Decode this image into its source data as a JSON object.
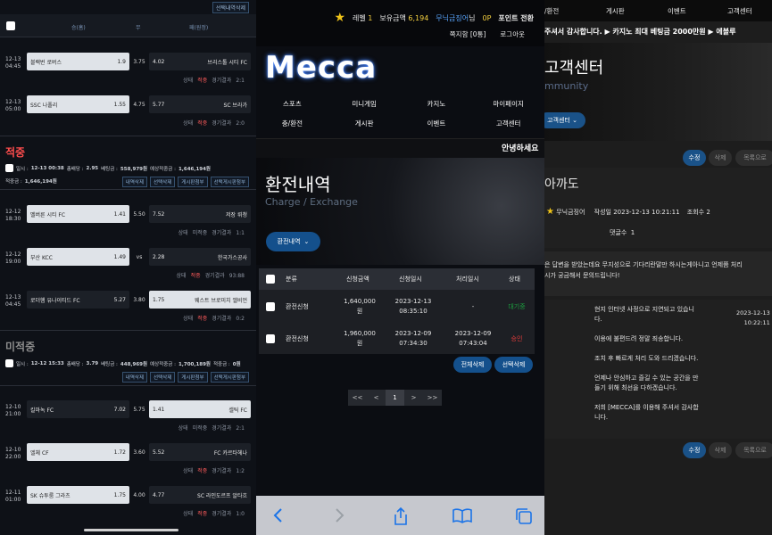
{
  "left": {
    "top_button": "선택내역삭제",
    "header": {
      "home": "승(홈)",
      "draw": "무",
      "away": "패(원정)"
    },
    "group1": [
      {
        "time1": "12-13",
        "time2": "04:45",
        "home": "블랙번 로버스",
        "home_odds": "1.9",
        "draw": "3.75",
        "away_odds": "4.02",
        "away": "브리스톨 시티 FC",
        "state": "상태",
        "mark": "적중",
        "result": "경기결과",
        "score": "2:1"
      },
      {
        "time1": "12-13",
        "time2": "05:00",
        "home": "SSC 나폴리",
        "home_odds": "1.55",
        "draw": "4.75",
        "away_odds": "5.77",
        "away": "SC 브라가",
        "state": "상태",
        "mark": "적중",
        "result": "경기결과",
        "score": "2:0"
      }
    ],
    "section_hit": "적중",
    "hit_info": {
      "date_label": "일시 :",
      "date": "12-13 00:38",
      "total_odds_label": "총배당 :",
      "total_odds": "2.95",
      "bet_label": "베팅금 :",
      "bet": "558,979원",
      "exp_label": "예상적중금 :",
      "exp": "1,646,194원",
      "win_label": "적중금 :",
      "win": "1,646,194원"
    },
    "buttons": [
      "내역삭제",
      "선택삭제",
      "게시판첨부",
      "선택게시판첨부"
    ],
    "group2": [
      {
        "time1": "12-12",
        "time2": "18:30",
        "home": "멜버른 시티 FC",
        "home_odds": "1.41",
        "draw": "5.50",
        "away_odds": "7.52",
        "away": "저장 뤼청",
        "state": "상태",
        "mark": "미적중",
        "result": "경기결과",
        "score": "1:1"
      },
      {
        "time1": "12-12",
        "time2": "19:00",
        "home": "부산 KCC",
        "home_odds": "1.49",
        "draw": "vs",
        "away_odds": "2.28",
        "away": "한국가스공사",
        "state": "상태",
        "mark": "적중",
        "result": "경기결과",
        "score": "93:88"
      },
      {
        "time1": "12-13",
        "time2": "04:45",
        "home": "로더햄 유나이티드 FC",
        "home_odds": "5.27",
        "draw": "3.80",
        "away_odds": "1.75",
        "away": "웨스트 브로미치 앨비언",
        "state": "상태",
        "mark": "적중",
        "result": "경기결과",
        "score": "0:2"
      }
    ],
    "section_miss": "미적중",
    "miss_info": {
      "date_label": "일시 :",
      "date": "12-12 15:33",
      "total_odds_label": "총배당 :",
      "total_odds": "3.79",
      "bet_label": "베팅금 :",
      "bet": "448,969원",
      "exp_label": "예상적중금 :",
      "exp": "1,700,189원",
      "win_label": "적중금 :",
      "win": "0원"
    },
    "group3": [
      {
        "time1": "12-10",
        "time2": "21:00",
        "home": "킬마녹 FC",
        "home_odds": "7.02",
        "draw": "5.75",
        "away_odds": "1.41",
        "away": "셀틱 FC",
        "state": "상태",
        "mark": "미적중",
        "result": "경기결과",
        "score": "2:1"
      },
      {
        "time1": "12-10",
        "time2": "22:00",
        "home": "엘체 CF",
        "home_odds": "1.72",
        "draw": "3.60",
        "away_odds": "5.52",
        "away": "FC 카르타헤나",
        "state": "상태",
        "mark": "적중",
        "result": "경기결과",
        "score": "1:2"
      },
      {
        "time1": "12-11",
        "time2": "01:00",
        "home": "SK 슈투룸 그라츠",
        "home_odds": "1.75",
        "draw": "4.00",
        "away_odds": "4.77",
        "away": "SC 라인도르프 알타흐",
        "state": "상태",
        "mark": "적중",
        "result": "경기결과",
        "score": "1:0"
      }
    ]
  },
  "mid": {
    "level_label": "레벨",
    "level": "1",
    "money_label": "보유금액",
    "money": "6,194",
    "user": "무닉금징어",
    "user_suffix": "님",
    "point": "0P",
    "point_btn": "포인트 전환",
    "msg": "쪽지함 [0통]",
    "logout": "로그아웃",
    "logo": "Mecca",
    "nav1": [
      "스포츠",
      "미니게임",
      "카지노",
      "마이페이지"
    ],
    "nav2": [
      "충/환전",
      "게시판",
      "이벤트",
      "고객센터"
    ],
    "greet": "안녕하세요",
    "hero_title": "환전내역",
    "hero_sub": "Charge / Exchange",
    "dropdown": "환전내역",
    "cols": [
      "분류",
      "신청금액",
      "신청일시",
      "처리일시",
      "상태"
    ],
    "rows": [
      {
        "type": "환전신청",
        "amount1": "1,640,000",
        "amount2": "원",
        "req1": "2023-12-13",
        "req2": "08:35:10",
        "done1": "-",
        "done2": "",
        "status": "대기중",
        "status_color": "#1c9d3e"
      },
      {
        "type": "환전신청",
        "amount1": "1,960,000",
        "amount2": "원",
        "req1": "2023-12-09",
        "req2": "07:34:30",
        "done1": "2023-12-09",
        "done2": "07:43:04",
        "status": "승인",
        "status_color": "#e23b3b"
      }
    ],
    "btn_all": "전체삭제",
    "btn_sel": "선택삭제",
    "pager": [
      "<<",
      "<",
      "1",
      ">",
      ">>"
    ]
  },
  "right": {
    "nav": [
      "/환전",
      "게시판",
      "이벤트",
      "고객센터"
    ],
    "marquee": "주셔서 감사합니다. ▶ 카지노 최대 베팅금 2000만원 ▶ 에볼루",
    "hero_title": "고객센터",
    "hero_sub": "mmunity",
    "dropdown": "고객센터",
    "btn_edit": "수정",
    "btn_del": "삭제",
    "btn_list": "목록으로",
    "post_title": "아까도",
    "author": "무닉금징어",
    "date_label": "작성일",
    "date": "2023-12-13 10:21:11",
    "views_label": "조회수",
    "views": "2",
    "comments_label": "댓글수",
    "comments": "1",
    "question1": "은 답변을 받았는데요 무지성으로 기다리란말만 하시는게아니고 언제쯤 처리",
    "question2": "시가 궁금해서 문의드립니다!",
    "answer": [
      "현지 인터넷 사정으로 지연되고 있습니",
      "다.",
      "",
      "이용에 불편드려 정말 죄송합니다.",
      "",
      "조치 후 빠르게 처리 도와 드리겠습니다.",
      "",
      "언제나 안심하고 즐길 수 있는 공간을 만",
      "들기 위해 최선을 다하겠습니다.",
      "",
      "저희 [MECCA]를 이용해 주셔서 감사합",
      "니다."
    ],
    "answer_date1": "2023-12-13",
    "answer_date2": "10:22:11"
  }
}
